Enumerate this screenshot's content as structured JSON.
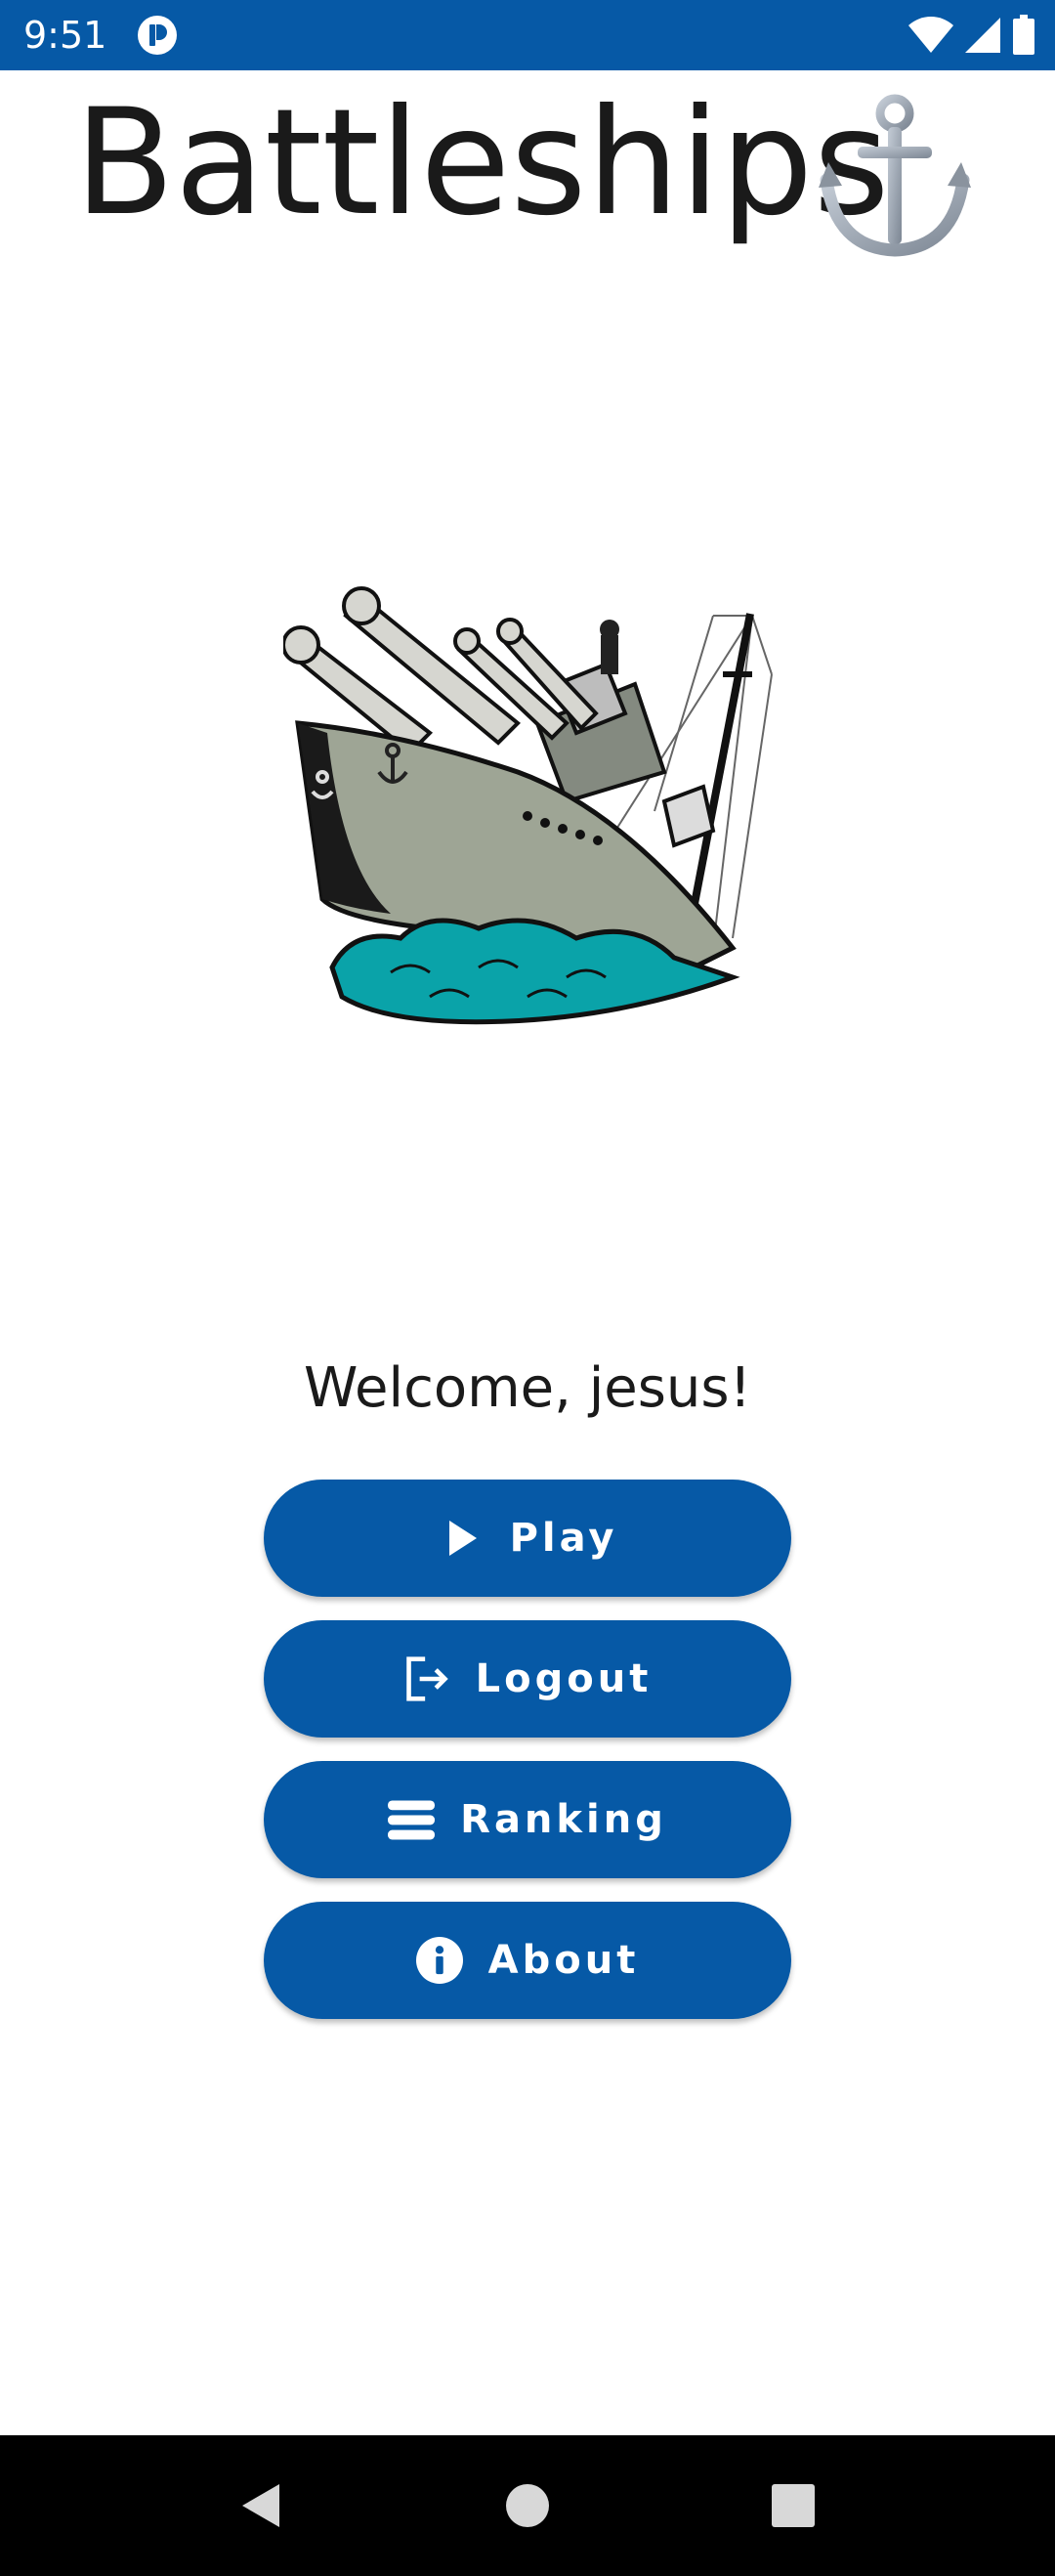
{
  "status_bar": {
    "time": "9:51",
    "icons": [
      "app-notification-icon",
      "wifi-icon",
      "cellular-signal-icon",
      "battery-icon"
    ]
  },
  "header": {
    "title": "Battleships",
    "emoji_icon": "anchor-icon"
  },
  "hero_image": "battleship-illustration",
  "welcome_text": "Welcome, jesus!",
  "menu": {
    "buttons": [
      {
        "label": "Play",
        "icon": "play-icon"
      },
      {
        "label": "Logout",
        "icon": "logout-icon"
      },
      {
        "label": "Ranking",
        "icon": "list-icon"
      },
      {
        "label": "About",
        "icon": "info-icon"
      }
    ]
  },
  "navigation_bar": {
    "buttons": [
      "back-icon",
      "home-icon",
      "recents-icon"
    ]
  },
  "colors": {
    "primary": "#0659a6",
    "status_bar": "#0659a6",
    "navigation_bar": "#000000",
    "text": "#1a1a1a"
  }
}
